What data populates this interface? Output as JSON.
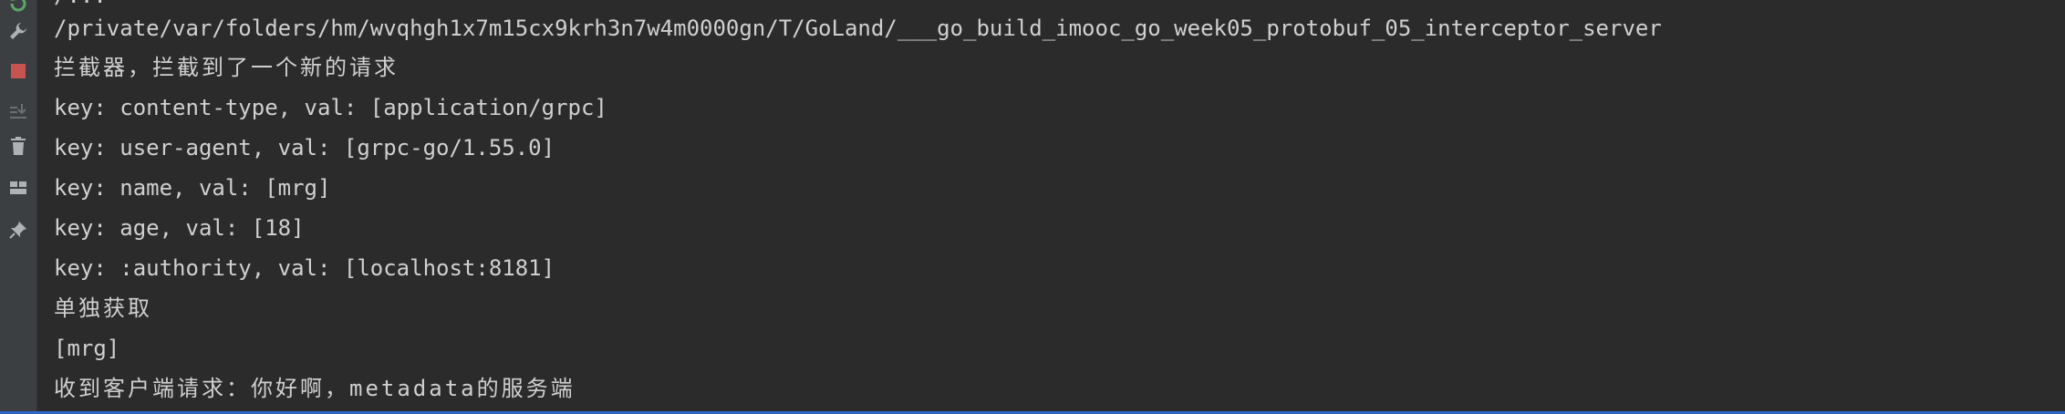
{
  "toolbar": {
    "icons": [
      {
        "name": "rerun-icon",
        "color": "#59a869"
      },
      {
        "name": "wrench-icon",
        "color": "#afb1b3"
      },
      {
        "name": "stop-icon",
        "color": "#c75450"
      },
      {
        "name": "scroll-to-end-icon",
        "color": "#6e6e6e"
      },
      {
        "name": "trash-icon",
        "color": "#afb1b3"
      },
      {
        "name": "layout-icon",
        "color": "#afb1b3"
      },
      {
        "name": "pin-icon",
        "color": "#afb1b3"
      }
    ]
  },
  "console": {
    "partial_top_line": "/...",
    "lines": [
      "/private/var/folders/hm/wvqhgh1x7m15cx9krh3n7w4m0000gn/T/GoLand/___go_build_imooc_go_week05_protobuf_05_interceptor_server",
      "拦截器，拦截到了一个新的请求",
      "key: content-type, val: [application/grpc]",
      "key: user-agent, val: [grpc-go/1.55.0]",
      "key: name, val: [mrg]",
      "key: age, val: [18]",
      "key: :authority, val: [localhost:8181]",
      "单独获取",
      "[mrg]",
      "收到客户端请求：你好啊，metadata的服务端"
    ]
  },
  "colors": {
    "background": "#2b2b2b",
    "toolbar": "#3c3f41",
    "text": "#d0d0d0",
    "accent": "#2f65ca"
  }
}
